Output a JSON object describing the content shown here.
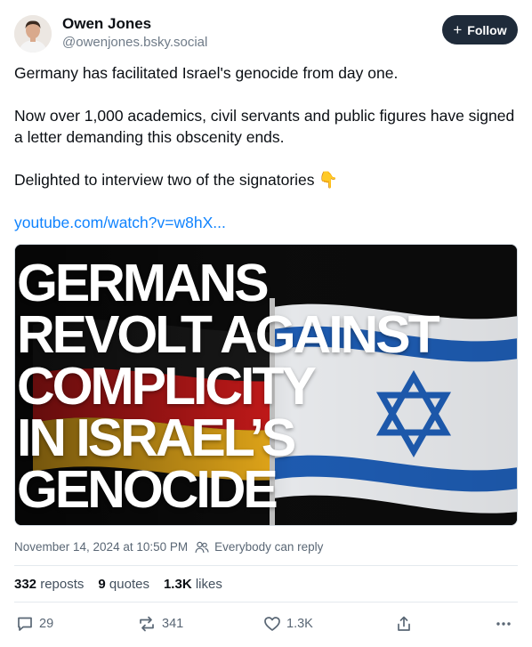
{
  "author": {
    "display_name": "Owen Jones",
    "handle": "@owenjones.bsky.social"
  },
  "follow_button": {
    "icon": "plus-icon",
    "label": "Follow"
  },
  "post": {
    "paragraphs": [
      "Germany has facilitated Israel's genocide from day one.",
      "Now over 1,000 academics, civil servants and public figures have signed a letter demanding this obscenity ends.",
      "Delighted to interview two of the signatories"
    ],
    "emoji": "👇",
    "link_text": "youtube.com/watch?v=w8hX..."
  },
  "embed": {
    "headline_lines": [
      "Germans",
      "revolt against",
      "complicity",
      "in Israel’s",
      "genocide"
    ]
  },
  "meta": {
    "timestamp": "November 14, 2024 at 10:50 PM",
    "reply_setting": "Everybody can reply"
  },
  "stats": {
    "reposts": {
      "count": "332",
      "label": "reposts"
    },
    "quotes": {
      "count": "9",
      "label": "quotes"
    },
    "likes": {
      "count": "1.3K",
      "label": "likes"
    }
  },
  "actions": {
    "reply_count": "29",
    "repost_count": "341",
    "like_count": "1.3K"
  },
  "colors": {
    "link": "#1083fe",
    "follow_bg": "#1f2b3a",
    "flag_black": "#111111",
    "flag_red": "#d11b1b",
    "flag_gold": "#f2b21b",
    "israel_blue": "#1f5fb8"
  }
}
